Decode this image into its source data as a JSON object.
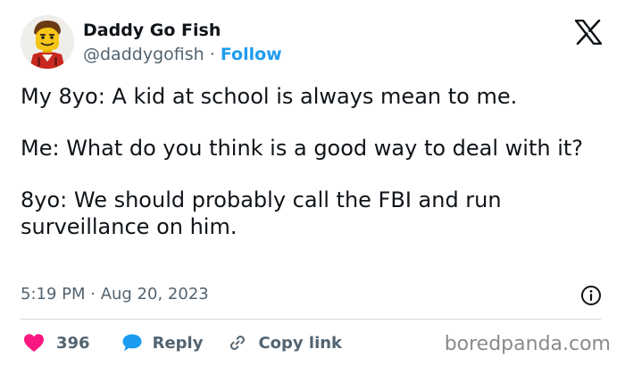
{
  "author": {
    "display_name": "Daddy Go Fish",
    "handle": "@daddygofish",
    "separator": "·",
    "follow_label": "Follow"
  },
  "icons": {
    "brand": "x-logo-icon",
    "info": "info-icon",
    "like": "heart-icon",
    "reply": "speech-bubble-icon",
    "copy": "link-icon"
  },
  "tweet": {
    "paragraphs": [
      "My 8yo: A kid at school is always mean to me.",
      "Me: What do you think is a good way to deal with it?",
      "8yo: We should probably call the FBI and run surveillance on him."
    ],
    "timestamp": "5:19 PM · Aug 20, 2023"
  },
  "actions": {
    "like_count": "396",
    "reply_label": "Reply",
    "copy_label": "Copy link"
  },
  "watermark": "boredpanda.com",
  "colors": {
    "text": "#0f1419",
    "secondary": "#536471",
    "link": "#1d9bf0",
    "like": "#f91880",
    "divider": "#cfd9de"
  }
}
